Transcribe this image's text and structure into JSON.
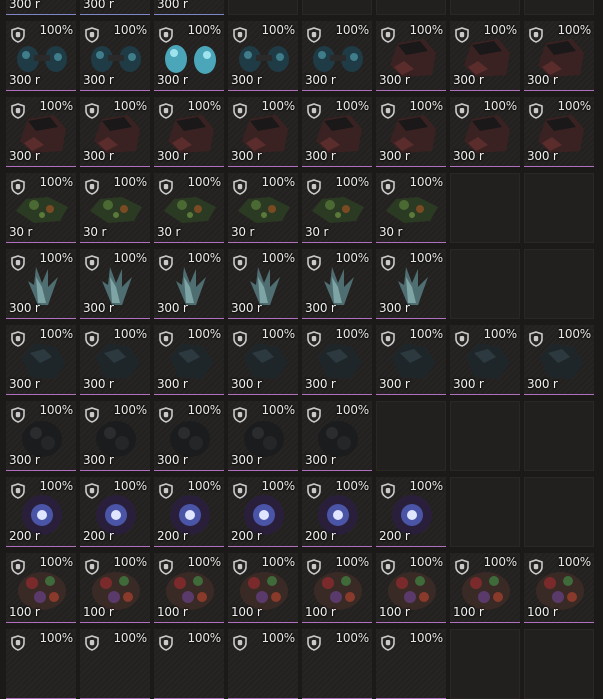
{
  "colors": {
    "background": "#1c1a18",
    "underline_blue": "#7f86c8",
    "underline_pink": "#b06fbf",
    "text": "#f0f0f0"
  },
  "rows": [
    {
      "underline": "blue",
      "art": "crystal",
      "slots": [
        {
          "pct": "",
          "price": "300 r"
        },
        {
          "pct": "",
          "price": "300 r"
        },
        {
          "pct": "",
          "price": "300 r"
        },
        null,
        null,
        null,
        null,
        null
      ]
    },
    {
      "underline": "pink",
      "art": "rock",
      "slots": [
        {
          "pct": "100%",
          "price": "300 r",
          "art": "crystal"
        },
        {
          "pct": "100%",
          "price": "300 r",
          "art": "crystal"
        },
        {
          "pct": "100%",
          "price": "300 r",
          "art": "crystal-bright"
        },
        {
          "pct": "100%",
          "price": "300 r",
          "art": "crystal"
        },
        {
          "pct": "100%",
          "price": "300 r",
          "art": "crystal"
        },
        {
          "pct": "100%",
          "price": "300 r",
          "art": "rock"
        },
        {
          "pct": "100%",
          "price": "300 r",
          "art": "rock"
        },
        {
          "pct": "100%",
          "price": "300 r",
          "art": "rock"
        }
      ]
    },
    {
      "underline": "pink",
      "art": "rock",
      "slots": [
        {
          "pct": "100%",
          "price": "300 r"
        },
        {
          "pct": "100%",
          "price": "300 r"
        },
        {
          "pct": "100%",
          "price": "300 r"
        },
        {
          "pct": "100%",
          "price": "300 r"
        },
        {
          "pct": "100%",
          "price": "300 r"
        },
        {
          "pct": "100%",
          "price": "300 r"
        },
        {
          "pct": "100%",
          "price": "300 r"
        },
        {
          "pct": "100%",
          "price": "300 r"
        }
      ]
    },
    {
      "underline": "pink",
      "art": "moss",
      "slots": [
        {
          "pct": "100%",
          "price": "30 r"
        },
        {
          "pct": "100%",
          "price": "30 r"
        },
        {
          "pct": "100%",
          "price": "30 r"
        },
        {
          "pct": "100%",
          "price": "30 r"
        },
        {
          "pct": "100%",
          "price": "30 r"
        },
        {
          "pct": "100%",
          "price": "30 r"
        },
        null,
        null
      ]
    },
    {
      "underline": "pink",
      "art": "shard",
      "slots": [
        {
          "pct": "100%",
          "price": "300 r"
        },
        {
          "pct": "100%",
          "price": "300 r"
        },
        {
          "pct": "100%",
          "price": "300 r"
        },
        {
          "pct": "100%",
          "price": "300 r"
        },
        {
          "pct": "100%",
          "price": "300 r"
        },
        {
          "pct": "100%",
          "price": "300 r"
        },
        null,
        null
      ]
    },
    {
      "underline": "pink",
      "art": "darkore",
      "slots": [
        {
          "pct": "100%",
          "price": "300 r"
        },
        {
          "pct": "100%",
          "price": "300 r"
        },
        {
          "pct": "100%",
          "price": "300 r"
        },
        {
          "pct": "100%",
          "price": "300 r"
        },
        {
          "pct": "100%",
          "price": "300 r"
        },
        {
          "pct": "100%",
          "price": "300 r"
        },
        {
          "pct": "100%",
          "price": "300 r"
        },
        {
          "pct": "100%",
          "price": "300 r"
        }
      ]
    },
    {
      "underline": "pink",
      "art": "coal",
      "slots": [
        {
          "pct": "100%",
          "price": "300 r"
        },
        {
          "pct": "100%",
          "price": "300 r"
        },
        {
          "pct": "100%",
          "price": "300 r"
        },
        {
          "pct": "100%",
          "price": "300 r"
        },
        {
          "pct": "100%",
          "price": "300 r"
        },
        null,
        null,
        null
      ]
    },
    {
      "underline": "pink",
      "art": "orb",
      "slots": [
        {
          "pct": "100%",
          "price": "200 r"
        },
        {
          "pct": "100%",
          "price": "200 r"
        },
        {
          "pct": "100%",
          "price": "200 r"
        },
        {
          "pct": "100%",
          "price": "200 r"
        },
        {
          "pct": "100%",
          "price": "200 r"
        },
        {
          "pct": "100%",
          "price": "200 r"
        },
        null,
        null
      ]
    },
    {
      "underline": "pink",
      "art": "flower",
      "slots": [
        {
          "pct": "100%",
          "price": "100 r"
        },
        {
          "pct": "100%",
          "price": "100 r"
        },
        {
          "pct": "100%",
          "price": "100 r"
        },
        {
          "pct": "100%",
          "price": "100 r"
        },
        {
          "pct": "100%",
          "price": "100 r"
        },
        {
          "pct": "100%",
          "price": "100 r"
        },
        {
          "pct": "100%",
          "price": "100 r"
        },
        {
          "pct": "100%",
          "price": "100 r"
        }
      ]
    },
    {
      "underline": "pink",
      "art": "none",
      "slots": [
        {
          "pct": "100%",
          "price": ""
        },
        {
          "pct": "100%",
          "price": ""
        },
        {
          "pct": "100%",
          "price": ""
        },
        {
          "pct": "100%",
          "price": ""
        },
        {
          "pct": "100%",
          "price": ""
        },
        {
          "pct": "100%",
          "price": ""
        },
        null,
        null
      ]
    }
  ]
}
